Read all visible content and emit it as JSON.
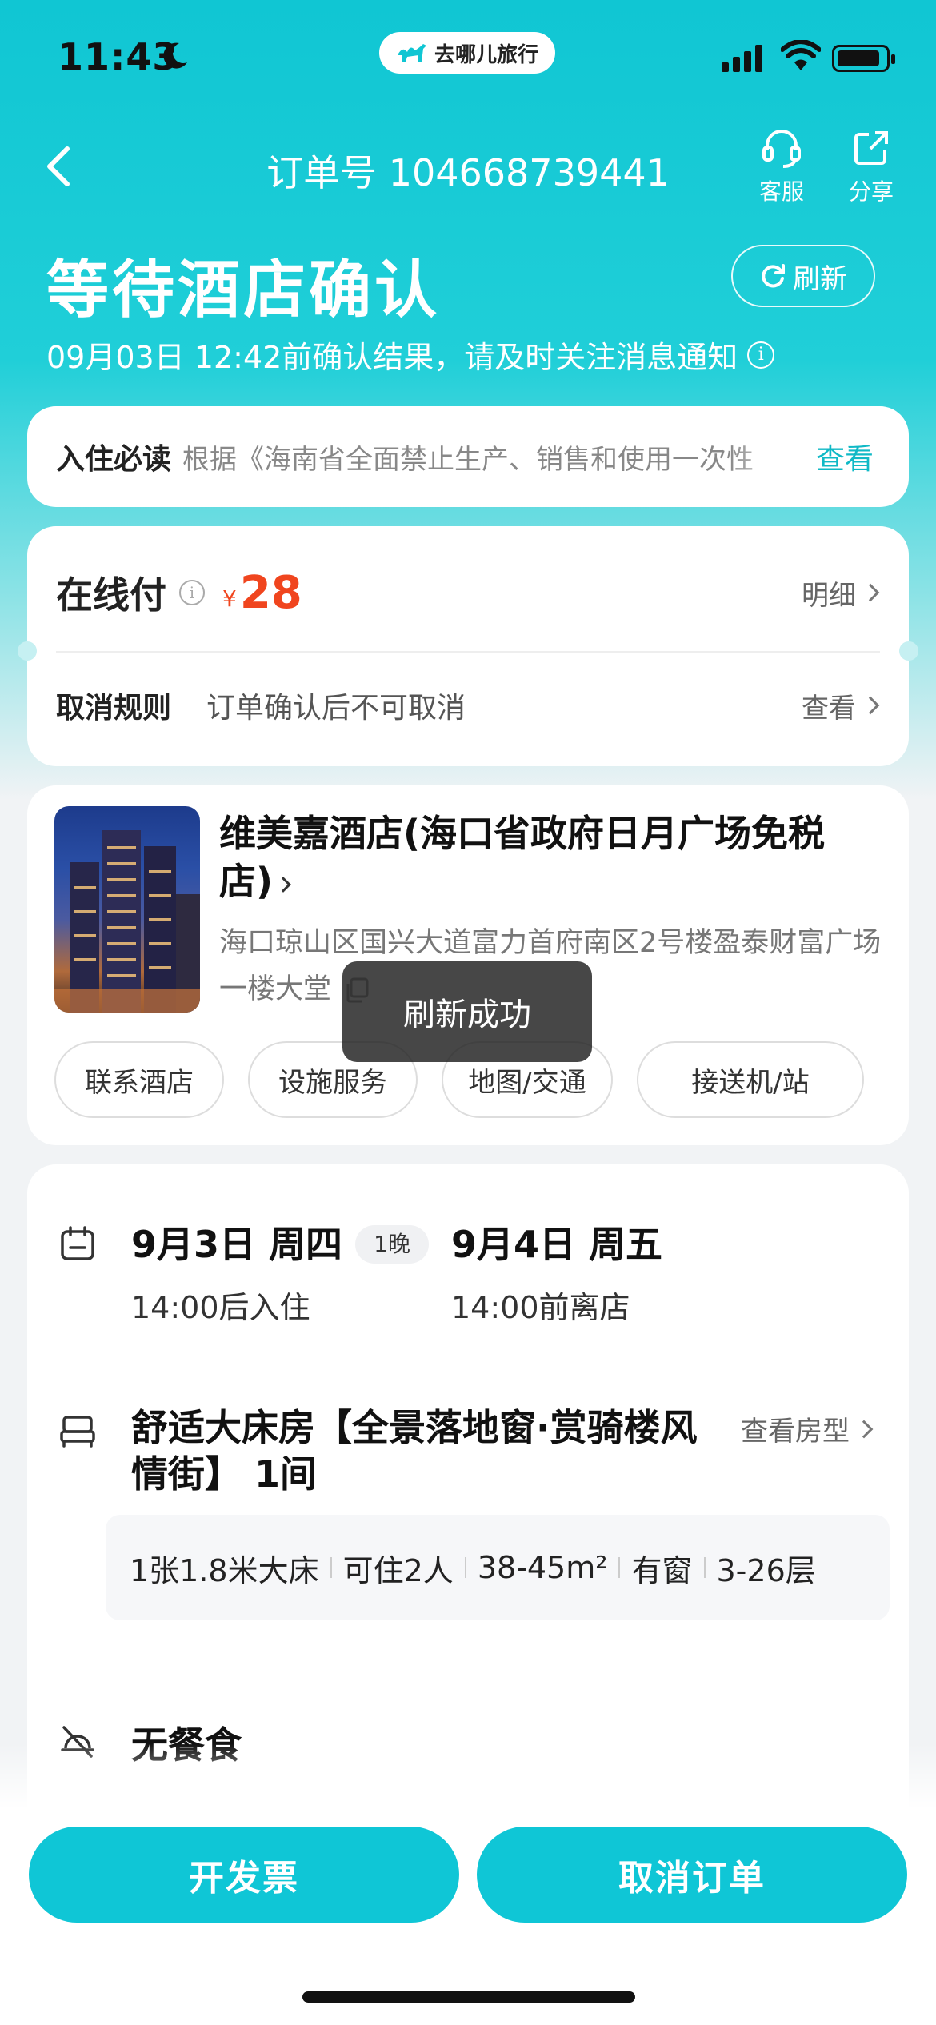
{
  "status_bar": {
    "time": "11:43",
    "brand": "去哪儿旅行"
  },
  "nav": {
    "title": "订单号 104668739441",
    "service_label": "客服",
    "share_label": "分享"
  },
  "status": {
    "title": "等待酒店确认",
    "refresh_label": "刷新",
    "subtitle": "09月03日 12:42前确认结果，请及时关注消息通知"
  },
  "notice": {
    "label": "入住必读",
    "text": "根据《海南省全面禁止生产、销售和使用一次性",
    "action": "查看"
  },
  "payment": {
    "label": "在线付",
    "currency": "¥",
    "amount": "28",
    "detail_label": "明细",
    "cancel_label": "取消规则",
    "cancel_value": "订单确认后不可取消",
    "cancel_action": "查看"
  },
  "hotel": {
    "name": "维美嘉酒店(海口省政府日月广场免税店)",
    "address": "海口琼山区国兴大道富力首府南区2号楼盈泰财富广场一楼大堂",
    "chips": [
      "联系酒店",
      "设施服务",
      "地图/交通",
      "接送机/站"
    ]
  },
  "toast": "刷新成功",
  "stay": {
    "checkin_date": "9月3日 周四",
    "checkin_time": "14:00后入住",
    "nights": "1晚",
    "checkout_date": "9月4日 周五",
    "checkout_time": "14:00前离店",
    "room_title": "舒适大床房【全景落地窗·赏骑楼风情街】 1间",
    "room_link": "查看房型",
    "specs": [
      "1张1.8米大床",
      "可住2人",
      "38-45m²",
      "有窗",
      "3-26层"
    ],
    "meal": "无餐食"
  },
  "actions": {
    "invoice": "开发票",
    "cancel_order": "取消订单"
  },
  "colors": {
    "accent": "#0fc6d6",
    "price": "#f0451e",
    "header_gradient_top": "#10c6d3"
  },
  "icons": [
    "moon-icon",
    "camel-logo-icon",
    "signal-icon",
    "wifi-icon",
    "battery-icon",
    "back-icon",
    "headset-icon",
    "share-icon",
    "refresh-icon",
    "info-icon",
    "chevron-right-icon",
    "copy-icon",
    "calendar-icon",
    "bed-icon",
    "no-meal-icon"
  ]
}
